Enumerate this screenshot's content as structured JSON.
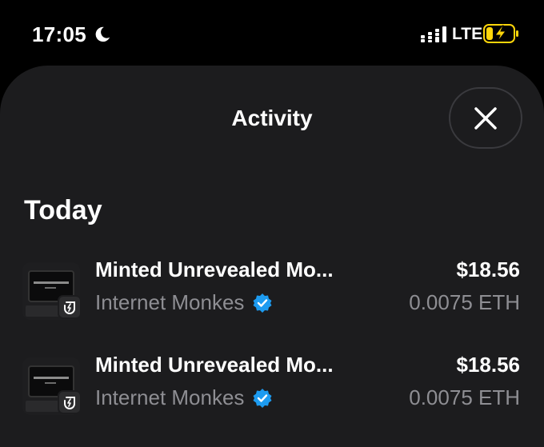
{
  "status_bar": {
    "time": "17:05",
    "network": "LTE",
    "icons": [
      "moon-icon",
      "signal-bars-icon",
      "battery-charging-icon"
    ]
  },
  "sheet": {
    "title": "Activity",
    "close_icon": "close-icon"
  },
  "section": {
    "heading": "Today"
  },
  "activities": [
    {
      "title": "Minted Unrevealed Mo...",
      "collection": "Internet Monkes",
      "usd": "$18.56",
      "eth": "0.0075 ETH",
      "thumb_text": "INTERNET MONKES"
    },
    {
      "title": "Minted Unrevealed Mo...",
      "collection": "Internet Monkes",
      "usd": "$18.56",
      "eth": "0.0075 ETH",
      "thumb_text": "INTERNET MONKES"
    }
  ],
  "colors": {
    "background": "#000000",
    "sheet": "#1c1c1e",
    "secondary_text": "#8e8e93",
    "verified_blue": "#1d9bf0",
    "battery_yellow": "#ffd60a"
  }
}
